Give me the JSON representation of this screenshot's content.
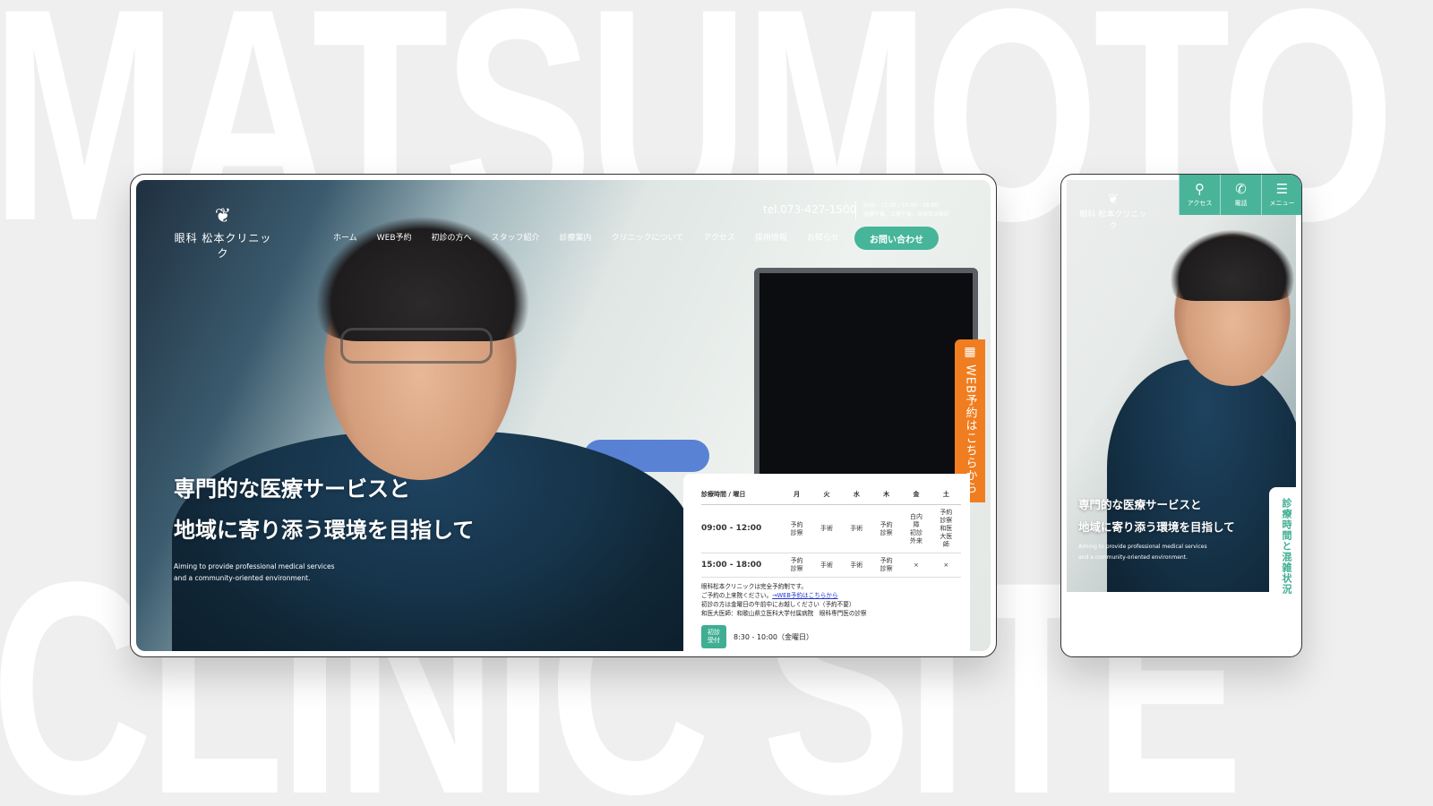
{
  "background": {
    "top_word": "MATSUMOTO",
    "bottom_word": "CLINIC SITE"
  },
  "desktop": {
    "logo": "眼科 松本クリニック",
    "nav": [
      "ホーム",
      "WEB予約",
      "初診の方へ",
      "スタッフ紹介",
      "診療案内",
      "クリニックについて",
      "アクセス",
      "採用情報",
      "お知らせ"
    ],
    "tel": "tel.073-427-1500",
    "hours_line1": "9:00 - 12:00 / 15:00 - 18:00",
    "hours_line2": "金曜午後、土曜午後、日祝日は休診",
    "contact_button": "お問い合わせ",
    "headline_line1": "専門的な医療サービスと",
    "headline_line2": "地域に寄り添う環境を目指して",
    "sub_line1": "Aiming to provide professional medical services",
    "sub_line2": "and a community-oriented environment.",
    "web_reserve": "WEB予約はこちらから",
    "schedule": {
      "header_label": "診療時間 / 曜日",
      "days": [
        "月",
        "火",
        "水",
        "木",
        "金",
        "土"
      ],
      "rows": [
        {
          "time": "09:00 - 12:00",
          "cells": [
            "予約\n診察",
            "手術",
            "手術",
            "予約\n診察",
            "白内\n障\n初診\n外来",
            "予約\n診察\n和医\n大医\n師"
          ]
        },
        {
          "time": "15:00 - 18:00",
          "cells": [
            "予約\n診察",
            "手術",
            "手術",
            "予約\n診察",
            "×",
            "×"
          ]
        }
      ],
      "note1": "眼科松本クリニックは完全予約制です。",
      "note2a": "ご予約の上来院ください。",
      "note2b": "→WEB予約はこちらから",
      "note3": "初診の方は金曜日の午前中にお越しください（予約不要）",
      "note4": "和医大医師：和歌山県立医科大学付属病院　眼科専門医の診察",
      "first_badge": "初診\n受付",
      "first_time": "8:30 - 10:00（金曜日）"
    }
  },
  "mobile": {
    "logo": "眼科 松本クリニック",
    "buttons": [
      {
        "icon": "pin-icon",
        "label": "アクセス"
      },
      {
        "icon": "phone-icon",
        "label": "電話"
      },
      {
        "icon": "menu-icon",
        "label": "メニュー"
      }
    ],
    "headline_line1": "専門的な医療サービスと",
    "headline_line2": "地域に寄り添う環境を目指して",
    "sub_line1": "Aiming to provide professional medical services",
    "sub_line2": "and a community-oriented environment.",
    "side_tab": "診療時間と混雑状況"
  },
  "colors": {
    "accent_green": "#46b59a",
    "accent_orange": "#f07d1f",
    "background": "#efefef"
  }
}
